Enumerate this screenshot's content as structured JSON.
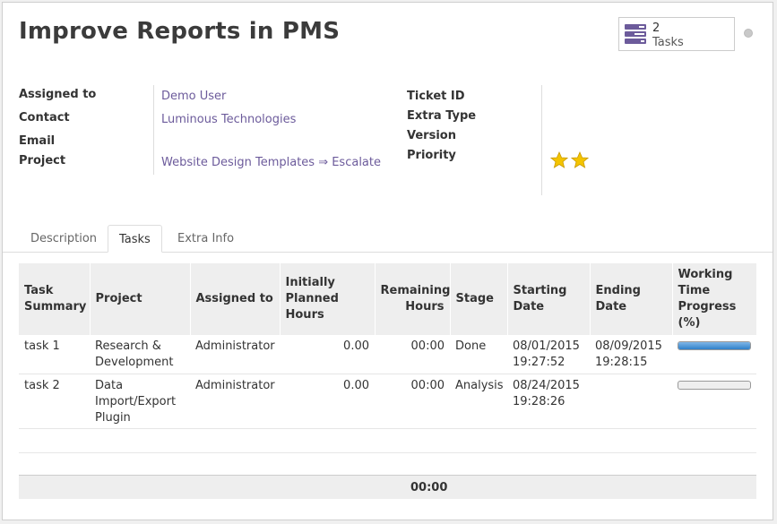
{
  "record": {
    "title": "Improve Reports in PMS"
  },
  "smart_button": {
    "count": "2",
    "label": "Tasks",
    "icon": "tasks-icon"
  },
  "fields_left": [
    {
      "label": "Assigned to",
      "value": "Demo User"
    },
    {
      "label": "Contact",
      "value": "Luminous Technologies"
    },
    {
      "label": "Email",
      "value": ""
    },
    {
      "label": "Project",
      "value": "Website Design Templates ⇒ Escalate"
    }
  ],
  "fields_right": [
    {
      "label": "Ticket ID",
      "value": ""
    },
    {
      "label": "Extra Type",
      "value": ""
    },
    {
      "label": "Version",
      "value": ""
    },
    {
      "label": "Priority",
      "stars": 2
    }
  ],
  "tabs": [
    {
      "label": "Description",
      "active": false
    },
    {
      "label": "Tasks",
      "active": true
    },
    {
      "label": "Extra Info",
      "active": false
    }
  ],
  "tasks_table": {
    "headers": [
      "Task Summary",
      "Project",
      "Assigned to",
      "Initially Planned Hours",
      "Remaining Hours",
      "Stage",
      "Starting Date",
      "Ending Date",
      "Working Time Progress (%)"
    ],
    "rows": [
      {
        "summary": "task 1",
        "project": "Research & Development",
        "assigned": "Administrator",
        "planned": "0.00",
        "remaining": "00:00",
        "stage": "Done",
        "start": "08/01/2015 19:27:52",
        "end": "08/09/2015 19:28:15",
        "progress": 100
      },
      {
        "summary": "task 2",
        "project": "Data Import/Export Plugin",
        "assigned": "Administrator",
        "planned": "0.00",
        "remaining": "00:00",
        "stage": "Analysis",
        "start": "08/24/2015 19:28:26",
        "end": "",
        "progress": 0
      }
    ],
    "footer_total": "00:00"
  },
  "colors": {
    "link": "#6c5b9b",
    "star": "#f4c400",
    "progress": "#2f80c9"
  }
}
